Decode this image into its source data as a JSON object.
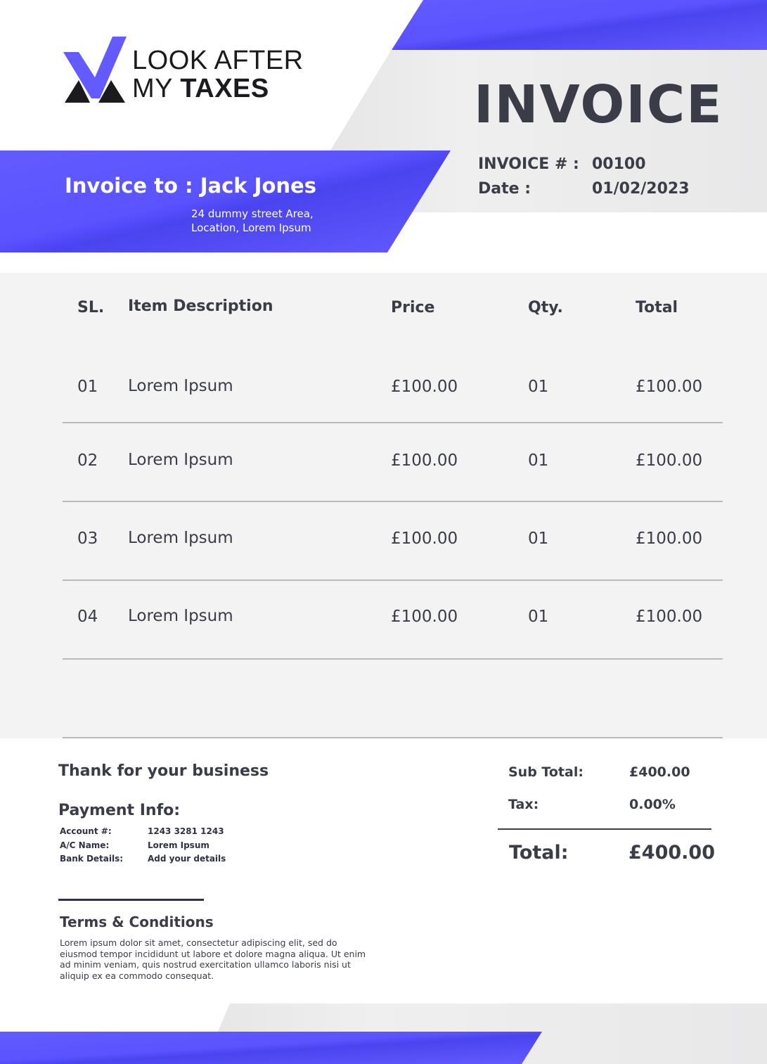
{
  "brand": {
    "logo_line1": "LOOK AFTER",
    "logo_line2_light": "MY ",
    "logo_line2_bold": "TAXES"
  },
  "colors": {
    "accent": "#635bff",
    "panel_gray": "#e9e9ea",
    "table_bg": "#f3f3f4",
    "text": "#3a3d47"
  },
  "invoice": {
    "title": "INVOICE",
    "number_label": "INVOICE # :",
    "number_value": "00100",
    "date_label": "Date :",
    "date_value": "01/02/2023"
  },
  "bill_to": {
    "title": "Invoice to : Jack Jones",
    "address_line1": "24 dummy street Area,",
    "address_line2": "Location, Lorem Ipsum"
  },
  "table": {
    "headers": [
      "SL.",
      "Item Description",
      "Price",
      "Qty.",
      "Total"
    ],
    "rows": [
      [
        "01",
        "Lorem Ipsum",
        "£100.00",
        "01",
        "£100.00"
      ],
      [
        "02",
        "Lorem Ipsum",
        "£100.00",
        "01",
        "£100.00"
      ],
      [
        "03",
        "Lorem Ipsum",
        "£100.00",
        "01",
        "£100.00"
      ],
      [
        "04",
        "Lorem Ipsum",
        "£100.00",
        "01",
        "£100.00"
      ]
    ]
  },
  "footer": {
    "thanks": "Thank for your business",
    "payment_title": "Payment Info:",
    "payment": [
      {
        "label": "Account #:",
        "value": "1243 3281 1243"
      },
      {
        "label": "A/C Name:",
        "value": "Lorem Ipsum"
      },
      {
        "label": "Bank Details:",
        "value": "Add your details"
      }
    ],
    "terms_title": "Terms & Conditions",
    "terms_text": "Lorem ipsum dolor sit amet, consectetur adipiscing elit, sed do eiusmod tempor incididunt ut labore et dolore magna aliqua. Ut enim ad minim veniam, quis nostrud exercitation ullamco laboris nisi ut aliquip ex ea commodo consequat."
  },
  "summary": {
    "subtotal_label": "Sub Total:",
    "subtotal_value": "£400.00",
    "tax_label": "Tax:",
    "tax_value": "0.00%",
    "total_label": "Total:",
    "total_value": "£400.00"
  }
}
